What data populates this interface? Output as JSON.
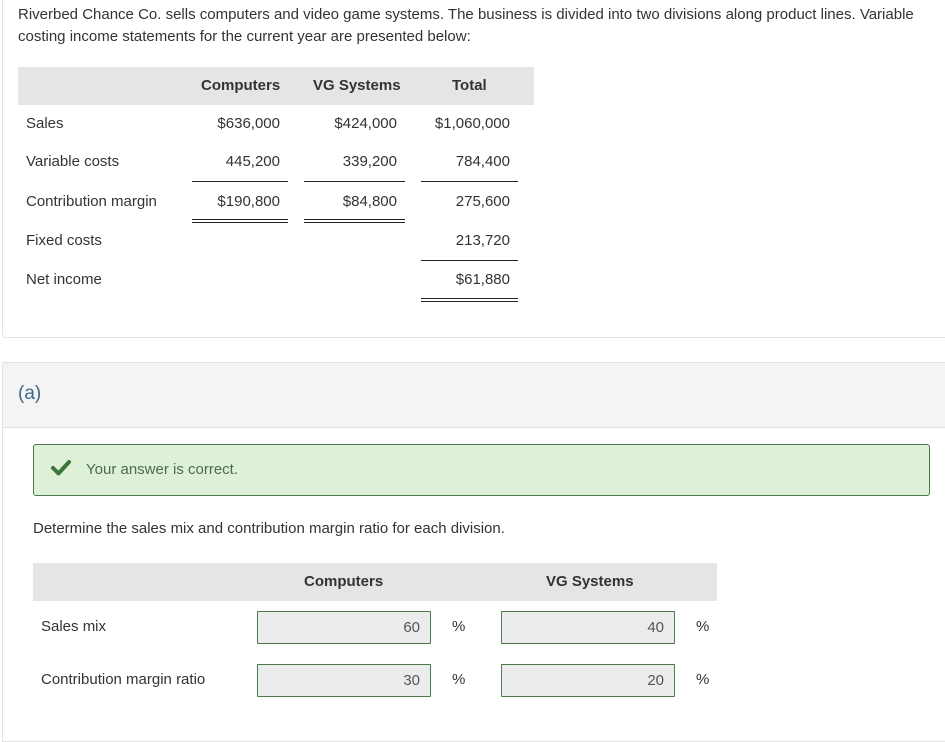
{
  "intro": "Riverbed Chance Co. sells computers and video game systems. The business is divided into two divisions along product lines. Variable costing income statements for the current year are presented below:",
  "income_statement": {
    "columns": [
      "Computers",
      "VG Systems",
      "Total"
    ],
    "rows": [
      {
        "label": "Sales",
        "values": [
          "$636,000",
          "$424,000",
          "$1,060,000"
        ]
      },
      {
        "label": "Variable costs",
        "values": [
          "445,200",
          "339,200",
          "784,400"
        ]
      },
      {
        "label": "Contribution margin",
        "values": [
          "$190,800",
          "$84,800",
          "275,600"
        ]
      },
      {
        "label": "Fixed costs",
        "values": [
          "",
          "",
          "213,720"
        ]
      },
      {
        "label": "Net income",
        "values": [
          "",
          "",
          "$61,880"
        ]
      }
    ]
  },
  "part": {
    "label": "(a)",
    "feedback": {
      "icon": "check-icon",
      "text": "Your answer is correct.",
      "color": "#3c763d"
    },
    "instruction": "Determine the sales mix and contribution margin ratio for each division.",
    "columns": [
      "Computers",
      "VG Systems"
    ],
    "rows": [
      {
        "label": "Sales mix",
        "values": [
          "60",
          "40"
        ],
        "unit": "%"
      },
      {
        "label": "Contribution margin ratio",
        "values": [
          "30",
          "20"
        ],
        "unit": "%"
      }
    ]
  }
}
